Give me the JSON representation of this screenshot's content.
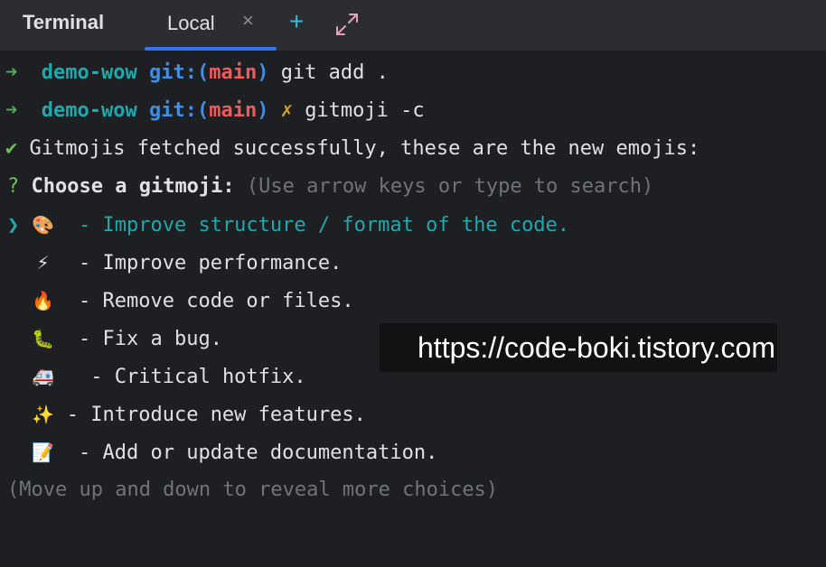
{
  "tabbar": {
    "tool_title": "Terminal",
    "tab_label": "Local",
    "close_glyph": "×",
    "add_glyph": "+",
    "expand_icon": "expand-icon",
    "accent_color": "#3574f0"
  },
  "lines": [
    {
      "arrow": "➜",
      "dir": "demo-wow",
      "git_prefix": "git:(",
      "branch": "main",
      "git_suffix": ")",
      "command": "git add ."
    },
    {
      "arrow": "➜",
      "dir": "demo-wow",
      "git_prefix": "git:(",
      "branch": "main",
      "git_suffix": ")",
      "dirty": "✗",
      "command": "gitmoji -c"
    }
  ],
  "fetched": {
    "check": "✔",
    "text": "Gitmojis fetched successfully, these are the new emojis:"
  },
  "prompt": {
    "mark": "?",
    "question": "Choose a gitmoji:",
    "hint": "(Use arrow keys or type to search)"
  },
  "choices": [
    {
      "selected": true,
      "cursor": "❯",
      "emoji": "🎨",
      "icon": "palette-icon",
      "text": "- Improve structure / format of the code."
    },
    {
      "selected": false,
      "emoji": "⚡",
      "icon": "lightning-icon",
      "text": "- Improve performance."
    },
    {
      "selected": false,
      "emoji": "🔥",
      "icon": "fire-icon",
      "text": "- Remove code or files."
    },
    {
      "selected": false,
      "emoji": "🐛",
      "icon": "bug-icon",
      "text": "- Fix a bug."
    },
    {
      "selected": false,
      "emoji": "🚑",
      "icon": "ambulance-icon",
      "text": " - Critical hotfix."
    },
    {
      "selected": false,
      "emoji": "✨",
      "icon": "sparkles-icon",
      "text": "- Introduce new features."
    },
    {
      "selected": false,
      "emoji": "📝",
      "icon": "memo-icon",
      "text": " - Add or update documentation."
    }
  ],
  "footer_hint": "(Move up and down to reveal more choices)",
  "watermark": "https://code-boki.tistory.com"
}
